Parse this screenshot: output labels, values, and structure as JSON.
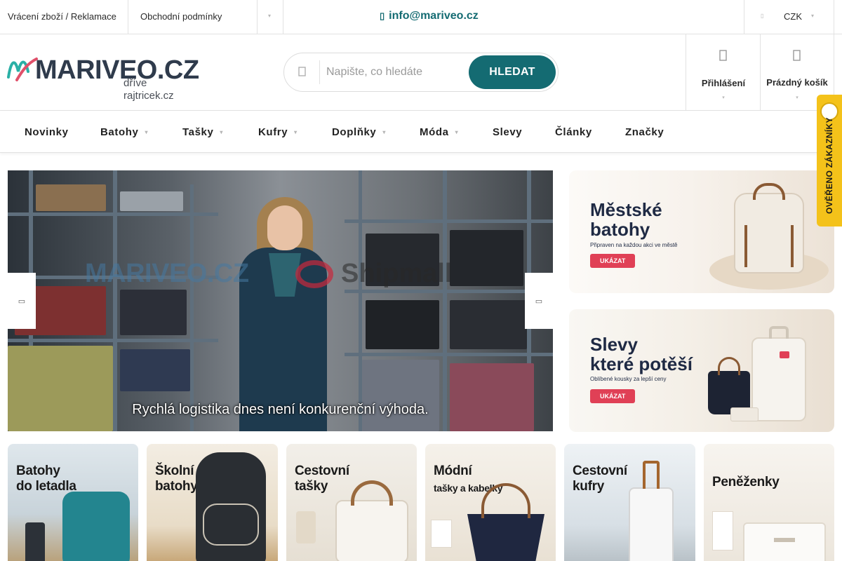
{
  "topbar": {
    "links": [
      "Vrácení zboží / Reklamace",
      "Obchodní podmínky"
    ],
    "email": "info@mariveo.cz",
    "currency": "CZK"
  },
  "header": {
    "logo_text": "MARIVEO.CZ",
    "logo_subtext": "dříve rajtricek.cz",
    "search_placeholder": "Napište, co hledáte",
    "search_button": "HLEDAT",
    "login_label": "Přihlášení",
    "cart_label": "Prázdný košík"
  },
  "nav": {
    "items": [
      {
        "label": "Novinky",
        "has_dropdown": false
      },
      {
        "label": "Batohy",
        "has_dropdown": true
      },
      {
        "label": "Tašky",
        "has_dropdown": true
      },
      {
        "label": "Kufry",
        "has_dropdown": true
      },
      {
        "label": "Doplňky",
        "has_dropdown": true
      },
      {
        "label": "Móda",
        "has_dropdown": true
      },
      {
        "label": "Slevy",
        "has_dropdown": false
      },
      {
        "label": "Články",
        "has_dropdown": false
      },
      {
        "label": "Značky",
        "has_dropdown": false
      }
    ]
  },
  "hero": {
    "watermark_left": "MARIVEO.CZ",
    "watermark_right": "Shipmall",
    "caption": "Rychlá logistika dnes není konkurenční výhoda."
  },
  "banners": [
    {
      "title_line1": "Městské",
      "title_line2": "batohy",
      "subtitle": "Připraven na každou akci ve městě",
      "button": "UKÁZAT"
    },
    {
      "title_line1": "Slevy",
      "title_line2": "které potěší",
      "subtitle": "Oblíbené kousky za lepší ceny",
      "button": "UKÁZAT"
    }
  ],
  "tiles": [
    {
      "line1": "Batohy",
      "line2": "do letadla"
    },
    {
      "line1": "Školní",
      "line2": "batohy"
    },
    {
      "line1": "Cestovní",
      "line2": "tašky"
    },
    {
      "line1": "Módní",
      "line2": "tašky a kabelky"
    },
    {
      "line1": "Cestovní",
      "line2": "kufry"
    },
    {
      "line1": "Peněženky",
      "line2": ""
    }
  ],
  "badge": {
    "text": "OVĚŘENO ZÁKAZNÍKY"
  },
  "colors": {
    "accent": "#146b72",
    "badge": "#f4c21a",
    "banner_button": "#e04056"
  }
}
